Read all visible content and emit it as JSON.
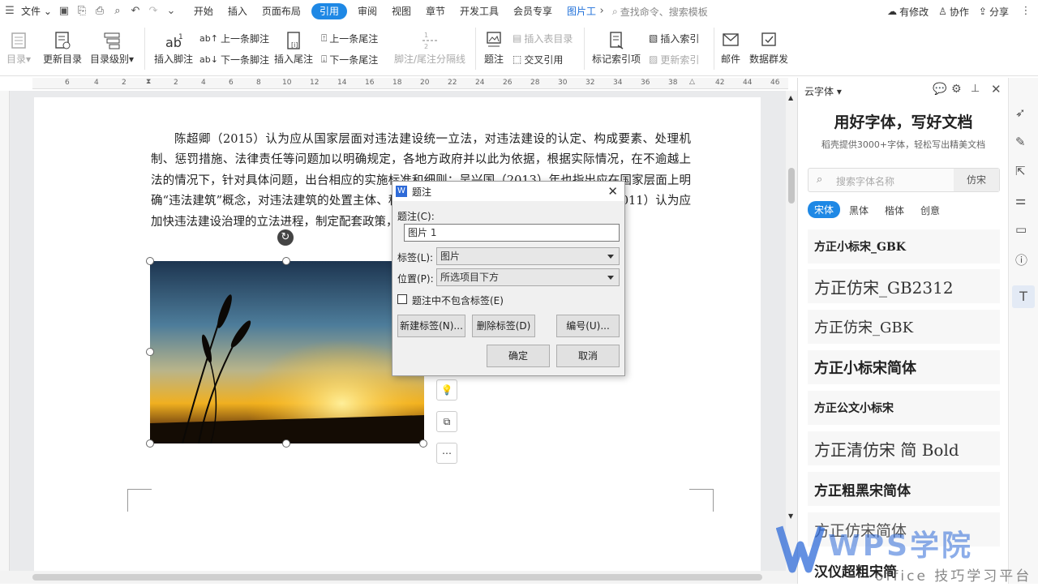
{
  "menubar": {
    "file_label": "文件",
    "tabs": [
      "开始",
      "插入",
      "页面布局",
      "引用",
      "审阅",
      "视图",
      "章节",
      "开发工具",
      "会员专享",
      "图片工"
    ],
    "active_tab": "引用",
    "search_placeholder": "查找命令、搜索模板",
    "status_modified": "有修改",
    "collab": "协作",
    "share": "分享"
  },
  "ribbon": {
    "toc": "目录",
    "update_toc": "更新目录",
    "toc_level": "目录级别",
    "insert_footnote": "插入脚注",
    "prev_footnote": "上一条脚注",
    "next_footnote": "下一条脚注",
    "insert_endnote": "插入尾注",
    "prev_endnote": "上一条尾注",
    "next_endnote": "下一条尾注",
    "footnote_sep": "脚注/尾注分隔线",
    "caption": "题注",
    "insert_table_toc": "插入表目录",
    "cross_ref": "交叉引用",
    "mark_index": "标记索引项",
    "insert_index": "插入索引",
    "update_index": "更新索引",
    "mail": "邮件",
    "data_mass": "数据群发"
  },
  "ruler": {
    "ticks": [
      "6",
      "4",
      "2",
      "2",
      "4",
      "6",
      "8",
      "10",
      "12",
      "14",
      "16",
      "18",
      "20",
      "22",
      "24",
      "26",
      "28",
      "30",
      "32",
      "34",
      "36",
      "38",
      "42",
      "44",
      "46"
    ]
  },
  "document": {
    "paragraph": "陈超卿（2015）认为应从国家层面对违法建设统一立法，对违法建设的认定、构成要素、处理机制、惩罚措施、法律责任等问题加以明确规定，各地方政府并以此为依据，根据实际情况，在不逾越上法的情况下，针对具体问题，出台相应的实施标准和细则；吴兴国（2013）年也指出应在国家层面上明确“违法建筑”概念，对违法建筑的处置主体、程序、方式作出合理明确的规定；毕志强（2011）认为应加快违法建设治理的立法进程，制定配套政策，解决处置依据不足的问题。"
  },
  "dialog": {
    "title": "题注",
    "caption_label": "题注(C):",
    "caption_value": "图片 1",
    "tag_label": "标签(L):",
    "tag_value": "图片",
    "position_label": "位置(P):",
    "position_value": "所选项目下方",
    "exclude_label": "题注中不包含标签(E)",
    "exclude_checked": false,
    "new_tag": "新建标签(N)...",
    "delete_tag": "删除标签(D)",
    "numbering": "编号(U)...",
    "ok": "确定",
    "cancel": "取消"
  },
  "side_panel": {
    "header": "云字体",
    "title": "用好字体，写好文档",
    "subtitle": "稻壳提供3000+字体，轻松写出精美文档",
    "search_placeholder": "搜索字体名称",
    "search_tag": "仿宋",
    "tabs": [
      "宋体",
      "黑体",
      "楷体",
      "创意"
    ],
    "active_tab": "宋体",
    "fonts": [
      "方正小标宋_GBK",
      "方正仿宋_GB2312",
      "方正仿宋_GBK",
      "方正小标宋简体",
      "方正公文小标宋",
      "方正清仿宋 简 Bold",
      "方正粗黑宋简体",
      "方正仿宋简体",
      "汉仪超粗宋简"
    ]
  },
  "watermark": {
    "brand": "WPS学院",
    "tagline": "office 技巧学习平台"
  },
  "colors": {
    "accent": "#1e88e5",
    "dialog_bg": "#f0f0f0",
    "wps_blue": "#2f6bd8"
  }
}
